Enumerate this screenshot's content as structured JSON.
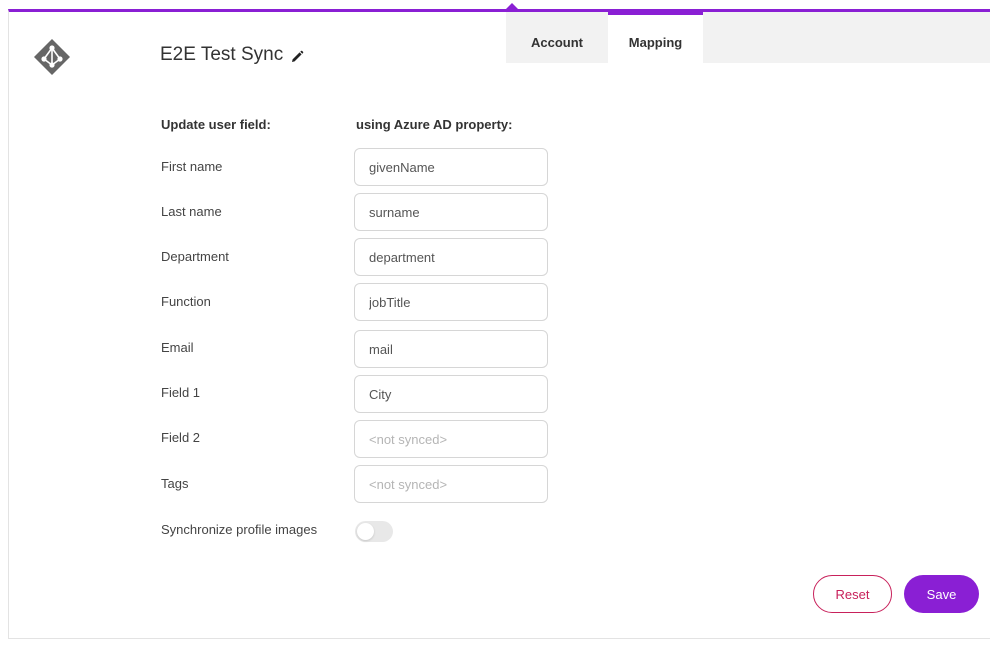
{
  "header": {
    "title": "E2E Test Sync",
    "logo_icon": "azure-ad-logo-icon",
    "edit_icon": "pencil-icon"
  },
  "tabs": [
    {
      "label": "Account",
      "active": false
    },
    {
      "label": "Mapping",
      "active": true
    }
  ],
  "mapping": {
    "col_left": "Update user field:",
    "col_right": "using Azure AD property:",
    "rows": [
      {
        "label": "First name",
        "value": "givenName",
        "placeholder": ""
      },
      {
        "label": "Last name",
        "value": "surname",
        "placeholder": ""
      },
      {
        "label": "Department",
        "value": "department",
        "placeholder": ""
      },
      {
        "label": "Function",
        "value": "jobTitle",
        "placeholder": ""
      },
      {
        "label": "Email",
        "value": "mail",
        "placeholder": ""
      },
      {
        "label": "Field 1",
        "value": "City",
        "placeholder": ""
      },
      {
        "label": "Field 2",
        "value": "",
        "placeholder": "<not synced>"
      },
      {
        "label": "Tags",
        "value": "",
        "placeholder": "<not synced>"
      }
    ],
    "sync_images_label": "Synchronize profile images",
    "sync_images_on": false
  },
  "actions": {
    "reset_label": "Reset",
    "save_label": "Save"
  },
  "colors": {
    "accent": "#8a1fd4",
    "reset": "#c8215b"
  }
}
